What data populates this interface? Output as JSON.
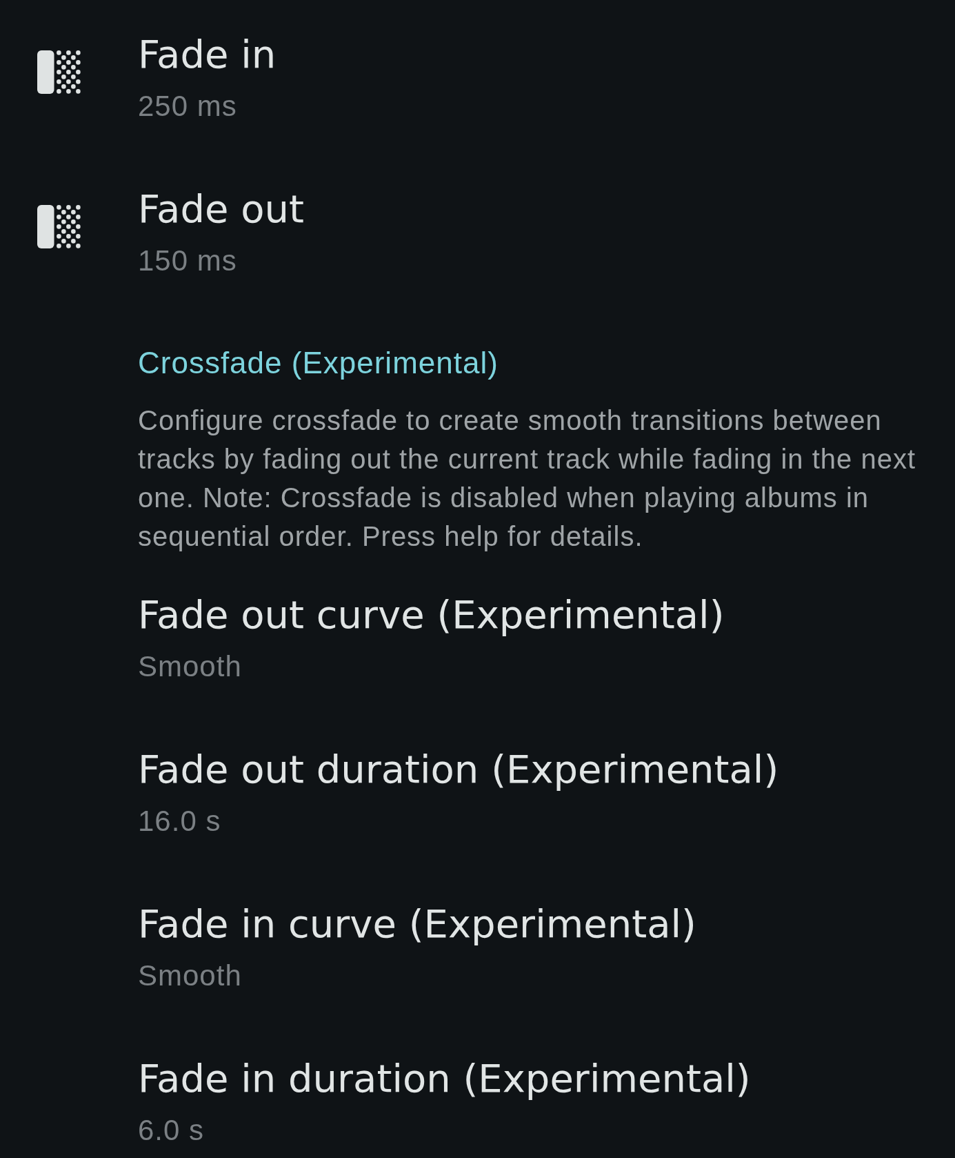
{
  "settings": [
    {
      "title": "Fade in",
      "value": "250 ms"
    },
    {
      "title": "Fade out",
      "value": "150 ms"
    }
  ],
  "crossfade": {
    "header": "Crossfade (Experimental)",
    "description": "Configure crossfade to create smooth transitions between tracks by fading out the current track while fading in the next one. Note: Crossfade is disabled when playing albums in sequential order. Press help for details.",
    "settings": [
      {
        "title": "Fade out curve (Experimental)",
        "value": "Smooth"
      },
      {
        "title": "Fade out duration (Experimental)",
        "value": "16.0 s"
      },
      {
        "title": "Fade in curve (Experimental)",
        "value": "Smooth"
      },
      {
        "title": "Fade in duration (Experimental)",
        "value": "6.0 s"
      }
    ]
  }
}
